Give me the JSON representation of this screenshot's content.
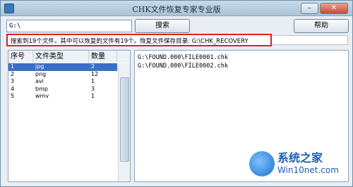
{
  "window": {
    "title": "CHK文件恢复专家专业版",
    "controls": {
      "minimize": "–",
      "close": "✕"
    }
  },
  "toolbar": {
    "path_value": "G:\\",
    "search_label": "搜索",
    "help_label": "帮助"
  },
  "status": {
    "text": "搜索到19个文件，其中可以恢复的文件有19个。恢复文件保存目录: G:\\CHK_RECOVERY"
  },
  "table": {
    "headers": [
      "序号",
      "文件类型",
      "数量"
    ],
    "rows": [
      {
        "index": "1",
        "type": "jpg",
        "count": "2"
      },
      {
        "index": "2",
        "type": "png",
        "count": "12"
      },
      {
        "index": "3",
        "type": "avi",
        "count": "1"
      },
      {
        "index": "4",
        "type": "bmp",
        "count": "3"
      },
      {
        "index": "5",
        "type": "wmv",
        "count": "1"
      }
    ]
  },
  "files": [
    "G:\\FOUND.000\\FILE0001.chk",
    "G:\\FOUND.000\\FILE0002.chk"
  ],
  "watermark": {
    "title": "系统之家",
    "subtitle": "Win10net.com"
  },
  "colors": {
    "selected_row": "#3b6fc4",
    "status_border": "#e02020"
  }
}
